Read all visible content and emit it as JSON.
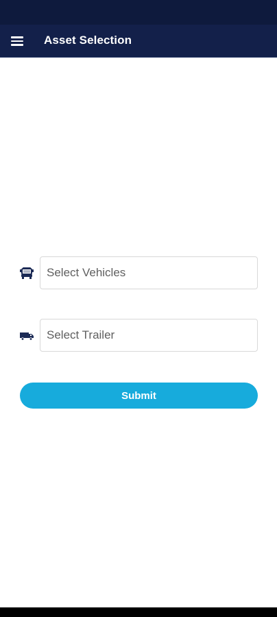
{
  "colors": {
    "status_bar": "#0e1a3d",
    "app_bar": "#13204a",
    "accent": "#17abdc",
    "icon": "#1b2a55"
  },
  "app_bar": {
    "menu_icon": "hamburger-menu-icon",
    "title": "Asset Selection"
  },
  "form": {
    "vehicle": {
      "icon": "truck-front-icon",
      "placeholder": "Select Vehicles",
      "value": ""
    },
    "trailer": {
      "icon": "trailer-truck-icon",
      "placeholder": "Select Trailer",
      "value": ""
    },
    "submit_label": "Submit"
  }
}
